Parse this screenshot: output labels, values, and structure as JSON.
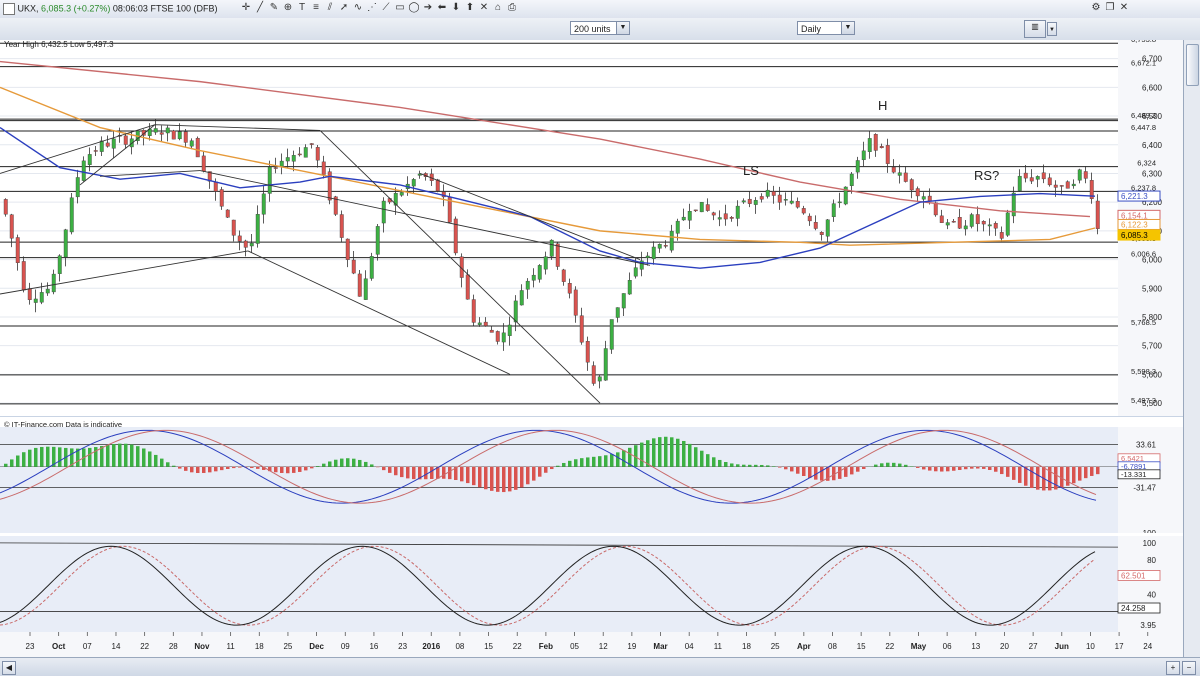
{
  "header": {
    "symbol": "UKX",
    "price": "6,085.3",
    "change": "(+0.27%)",
    "time": "08:06:03",
    "instrument": "FTSE 100 (DFB)"
  },
  "controls": {
    "units_select": "200 units",
    "period_select": "Daily"
  },
  "chart": {
    "info_text": "Year High 6,432.5 Low 5,497.3",
    "source_text": "© IT-Finance.com  Data is indicative",
    "annotations": {
      "ls": "LS",
      "h": "H",
      "rs": "RS?"
    },
    "price_axis": [
      {
        "label": "6,700",
        "v": 6700
      },
      {
        "label": "6,600",
        "v": 6600
      },
      {
        "label": "6,500",
        "v": 6500
      },
      {
        "label": "6,400",
        "v": 6400
      },
      {
        "label": "6,300",
        "v": 6300
      },
      {
        "label": "6,200",
        "v": 6200
      },
      {
        "label": "6,100",
        "v": 6100
      },
      {
        "label": "6,000",
        "v": 6000
      },
      {
        "label": "5,900",
        "v": 5900
      },
      {
        "label": "5,800",
        "v": 5800
      },
      {
        "label": "5,700",
        "v": 5700
      },
      {
        "label": "5,600",
        "v": 5600
      },
      {
        "label": "5,500",
        "v": 5500
      }
    ],
    "level_lines": [
      {
        "label": "6,753.8",
        "v": 6753.8
      },
      {
        "label": "6,672.1",
        "v": 6672.1
      },
      {
        "label": "6,489.3",
        "v": 6489.3
      },
      {
        "label": "6,447.8",
        "v": 6447.8
      },
      {
        "label": "6,324",
        "v": 6324
      },
      {
        "label": "6,237.8",
        "v": 6237.8
      },
      {
        "label": "6,060.8",
        "v": 6060.8
      },
      {
        "label": "6,006.6",
        "v": 6006.6
      },
      {
        "label": "5,768.5",
        "v": 5768.5
      },
      {
        "label": "5,598.3",
        "v": 5598.3
      },
      {
        "label": "5,497.3",
        "v": 5497.3
      }
    ],
    "value_tags": [
      {
        "label": "6,221.3",
        "v": 6221.3,
        "color": "#3b4fc4"
      },
      {
        "label": "6,154.1",
        "v": 6154.1,
        "color": "#d46a6a"
      },
      {
        "label": "6,122.3",
        "v": 6122.3,
        "color": "#e69a3a"
      },
      {
        "label": "6,085.3",
        "v": 6085.3,
        "color": "#f5c400"
      }
    ],
    "time_axis": [
      {
        "label": "23",
        "bold": false
      },
      {
        "label": "Oct",
        "bold": true
      },
      {
        "label": "07",
        "bold": false
      },
      {
        "label": "14",
        "bold": false
      },
      {
        "label": "22",
        "bold": false
      },
      {
        "label": "28",
        "bold": false
      },
      {
        "label": "Nov",
        "bold": true
      },
      {
        "label": "11",
        "bold": false
      },
      {
        "label": "18",
        "bold": false
      },
      {
        "label": "25",
        "bold": false
      },
      {
        "label": "Dec",
        "bold": true
      },
      {
        "label": "09",
        "bold": false
      },
      {
        "label": "16",
        "bold": false
      },
      {
        "label": "23",
        "bold": false
      },
      {
        "label": "2016",
        "bold": true
      },
      {
        "label": "08",
        "bold": false
      },
      {
        "label": "15",
        "bold": false
      },
      {
        "label": "22",
        "bold": false
      },
      {
        "label": "Feb",
        "bold": true
      },
      {
        "label": "05",
        "bold": false
      },
      {
        "label": "12",
        "bold": false
      },
      {
        "label": "19",
        "bold": false
      },
      {
        "label": "Mar",
        "bold": true
      },
      {
        "label": "04",
        "bold": false
      },
      {
        "label": "11",
        "bold": false
      },
      {
        "label": "18",
        "bold": false
      },
      {
        "label": "25",
        "bold": false
      },
      {
        "label": "Apr",
        "bold": true
      },
      {
        "label": "08",
        "bold": false
      },
      {
        "label": "15",
        "bold": false
      },
      {
        "label": "22",
        "bold": false
      },
      {
        "label": "May",
        "bold": true
      },
      {
        "label": "06",
        "bold": false
      },
      {
        "label": "13",
        "bold": false
      },
      {
        "label": "20",
        "bold": false
      },
      {
        "label": "27",
        "bold": false
      },
      {
        "label": "Jun",
        "bold": true
      },
      {
        "label": "10",
        "bold": false
      },
      {
        "label": "17",
        "bold": false
      },
      {
        "label": "24",
        "bold": false
      }
    ],
    "macd_axis": [
      {
        "label": "33.61",
        "v": 33.61
      },
      {
        "label": "-31.47",
        "v": -31.47
      },
      {
        "label": "-100",
        "v": -100
      }
    ],
    "macd_tags": [
      {
        "label": "6.5421",
        "color": "#d46a6a"
      },
      {
        "label": "-6.7891",
        "color": "#3b4fc4"
      },
      {
        "label": "-13.331",
        "color": "#222222"
      }
    ],
    "stoch_axis": [
      {
        "label": "100",
        "v": 100
      },
      {
        "label": "80",
        "v": 80
      },
      {
        "label": "40",
        "v": 40
      },
      {
        "label": "3.95",
        "v": 3.95
      }
    ],
    "stoch_tags": [
      {
        "label": "62.501",
        "color": "#d46a6a"
      },
      {
        "label": "24.258",
        "color": "#222222"
      }
    ],
    "colors": {
      "up": "#3cb043",
      "down": "#d9534f",
      "ma_blue": "#2b3fbf",
      "ma_red": "#c96b6b",
      "ma_orange": "#e69a3a"
    }
  }
}
